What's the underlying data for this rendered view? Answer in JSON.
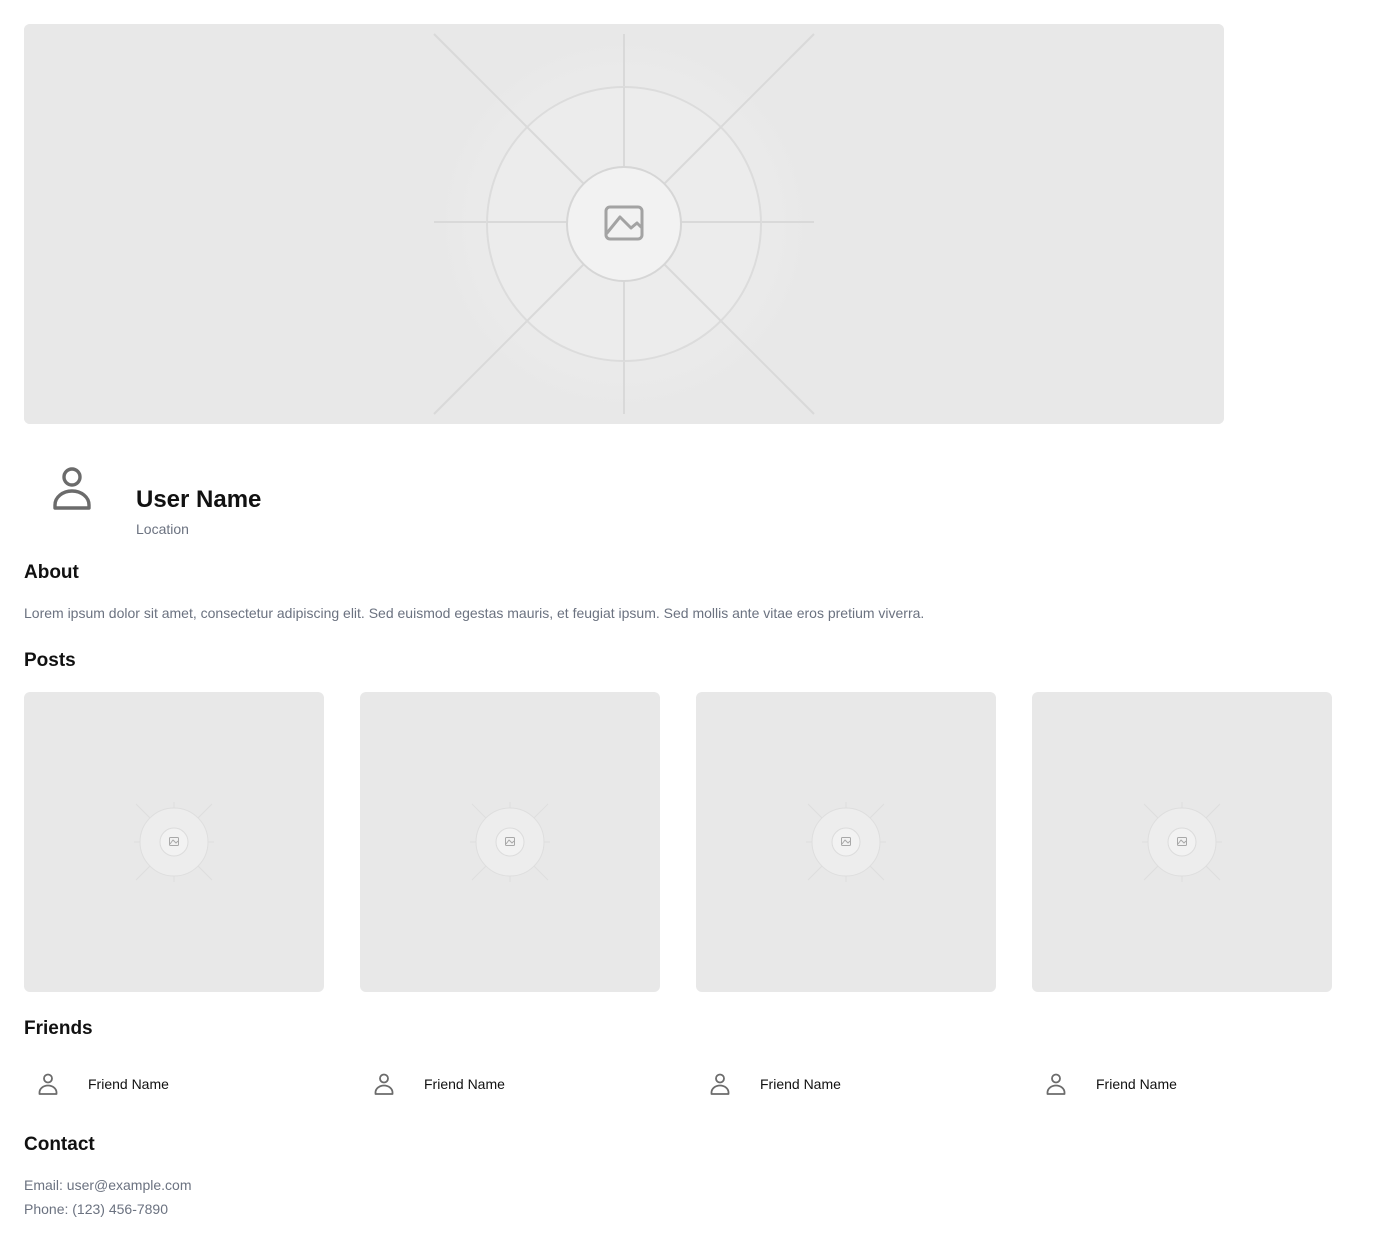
{
  "profile": {
    "name": "User Name",
    "location": "Location"
  },
  "about": {
    "title": "About",
    "text": "Lorem ipsum dolor sit amet, consectetur adipiscing elit. Sed euismod egestas mauris, et feugiat ipsum. Sed mollis ante vitae eros pretium viverra."
  },
  "posts": {
    "title": "Posts",
    "count": 4
  },
  "friends": {
    "title": "Friends",
    "items": [
      {
        "name": "Friend Name"
      },
      {
        "name": "Friend Name"
      },
      {
        "name": "Friend Name"
      },
      {
        "name": "Friend Name"
      }
    ]
  },
  "contact": {
    "title": "Contact",
    "email": "Email: user@example.com",
    "phone": "Phone: (123) 456-7890"
  },
  "colors": {
    "placeholder_bg": "#e8e8e8",
    "muted_text": "#6b7280",
    "icon": "#6b6b6b"
  },
  "icons": {
    "cover": "image-placeholder-icon",
    "avatar": "user-icon",
    "friend": "user-icon"
  }
}
